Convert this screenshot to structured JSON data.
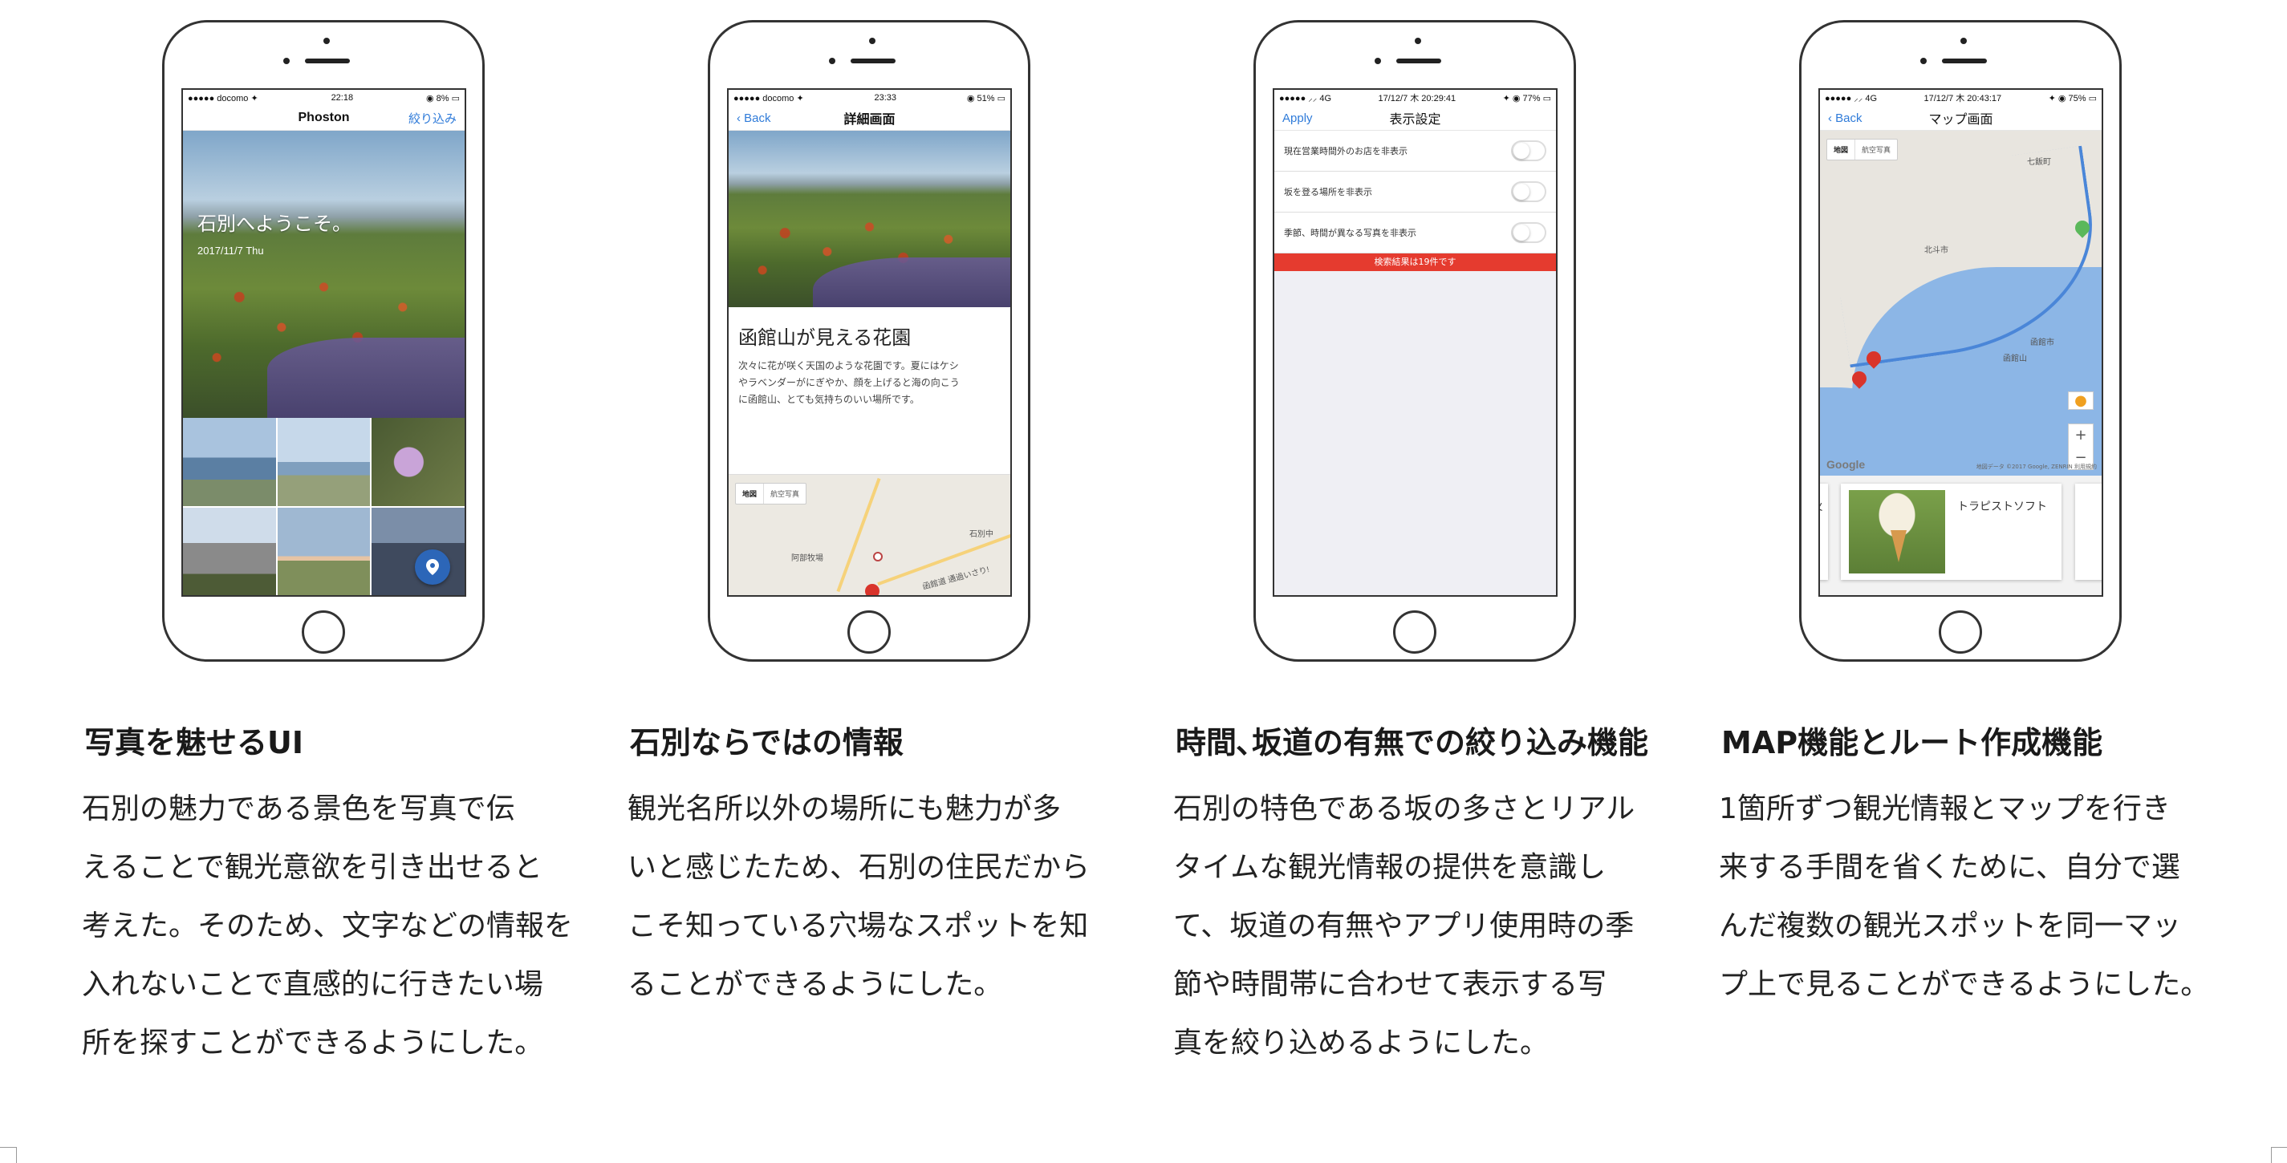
{
  "phones": {
    "home": {
      "status_left": "●●●●● docomo ✦",
      "status_time": "22:18",
      "status_right": "◉ 8% ▭",
      "nav_title": "Phoston",
      "nav_right": "絞り込み",
      "welcome": "石別へようこそ。",
      "date": "2017/11/7 Thu"
    },
    "detail": {
      "status_left": "●●●●● docomo ✦",
      "status_time": "23:33",
      "status_right": "◉ 51% ▭",
      "back": "Back",
      "nav_title": "詳細画面",
      "title": "函館山が見える花園",
      "desc_lines": [
        "次々に花が咲く天国のような花園です。夏にはケシ",
        "やラベンダーがにぎやか、顔を上げると海の向こう",
        "に函館山、とても気持ちのいい場所です。"
      ],
      "map_tab_map": "地図",
      "map_tab_photo": "航空写真",
      "map_label_1": "石別中",
      "map_label_2": "阿部牧場",
      "map_label_3": "函館道 通過いさり!"
    },
    "settings": {
      "status_left": "●●●●● ⸝⸝ 4G",
      "status_time": "17/12/7 木 20:29:41",
      "status_right": "✦ ◉ 77% ▭",
      "apply": "Apply",
      "nav_title": "表示設定",
      "rows": [
        "現在営業時間外のお店を非表示",
        "坂を登る場所を非表示",
        "季節、時間が異なる写真を非表示"
      ],
      "result": "検索結果は19件です"
    },
    "map": {
      "status_left": "●●●●● ⸝⸝ 4G",
      "status_time": "17/12/7 木 20:43:17",
      "status_right": "✦ ◉ 75% ▭",
      "back": "Back",
      "nav_title": "マップ画面",
      "map_tab_map": "地図",
      "map_tab_photo": "航空写真",
      "label_city1": "北斗市",
      "label_city2": "函館市",
      "label_mt": "函館山",
      "label_top": "七飯町",
      "google": "Google",
      "copyright": "地図データ ©2017 Google, ZENRIN 利用規約",
      "card_left_text": ")火",
      "card_name": "トラピストソフト",
      "zoom_in": "+",
      "zoom_out": "−"
    }
  },
  "captions": [
    {
      "heading": "写真を魅せるUI",
      "lines": [
        "石別の魅力である景色を写真で伝",
        "えることで観光意欲を引き出せると",
        "考えた。そのため、文字などの情報を",
        "入れないことで直感的に行きたい場",
        "所を探すことができるようにした。"
      ]
    },
    {
      "heading": "石別ならではの情報",
      "lines": [
        "観光名所以外の場所にも魅力が多",
        "いと感じたため、石別の住民だから",
        "こそ知っている穴場なスポットを知",
        "ることができるようにした。"
      ]
    },
    {
      "heading": "時間､坂道の有無での絞り込み機能",
      "lines": [
        "石別の特色である坂の多さとリアル",
        "タイムな観光情報の提供を意識し",
        "て、坂道の有無やアプリ使用時の季",
        "節や時間帯に合わせて表示する写",
        "真を絞り込めるようにした。"
      ]
    },
    {
      "heading": "MAP機能とルート作成機能",
      "lines": [
        "1箇所ずつ観光情報とマップを行き",
        "来する手間を省くために、自分で選",
        "んだ複数の観光スポットを同一マッ",
        "プ上で見ることができるようにした。"
      ]
    }
  ]
}
